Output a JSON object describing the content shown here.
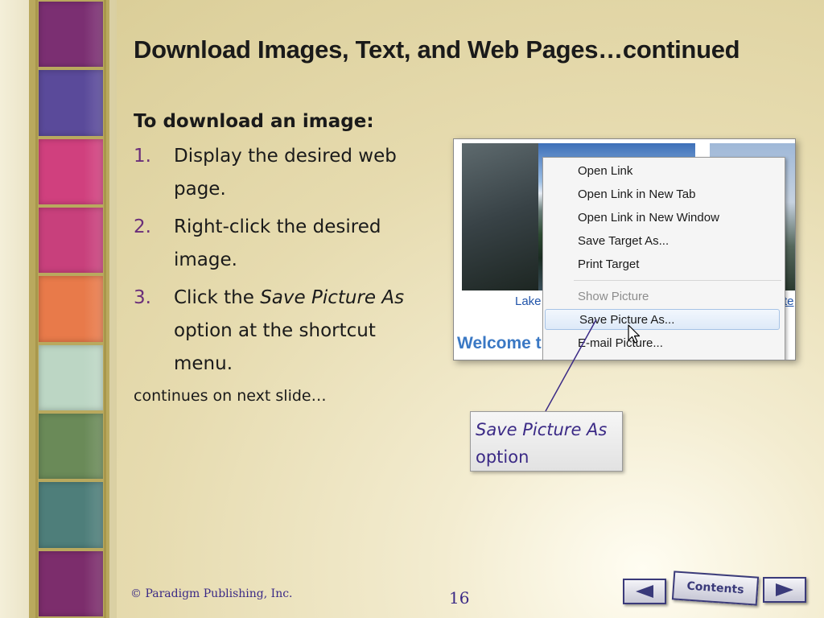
{
  "slide": {
    "title": "Download Images, Text, and Web Pages…continued",
    "subhead": "To download an image:",
    "steps": [
      {
        "num": "1.",
        "text": "Display the desired web page."
      },
      {
        "num": "2.",
        "text": "Right-click the desired image."
      },
      {
        "num": "3.",
        "text_before": "Click the ",
        "text_em": "Save Picture As",
        "text_after": " option at the shortcut menu."
      }
    ],
    "continues": "continues on next slide…"
  },
  "screenshot": {
    "caption_left": "Lake",
    "caption_right": "te",
    "welcome": "Welcome t",
    "menu": [
      {
        "label": "Open Link",
        "state": "normal"
      },
      {
        "label": "Open Link in New Tab",
        "state": "normal"
      },
      {
        "label": "Open Link in New Window",
        "state": "normal"
      },
      {
        "label": "Save Target As...",
        "state": "normal"
      },
      {
        "label": "Print Target",
        "state": "normal"
      },
      {
        "label": "Show Picture",
        "state": "disabled"
      },
      {
        "label": "Save Picture As...",
        "state": "highlighted"
      },
      {
        "label": "E-mail Picture...",
        "state": "normal"
      }
    ]
  },
  "callout": {
    "em": "Save Picture As",
    "rest": "option"
  },
  "footer": {
    "copyright": "© Paradigm Publishing, Inc.",
    "page": "16",
    "contents_label": "Contents"
  },
  "colors": {
    "accent_number": "#6a2e7a",
    "callout_text": "#3b2a86",
    "strip_swatches": [
      "#7b2f72",
      "#5a4a9a",
      "#d0407e",
      "#c8407c",
      "#e87a4a",
      "#bcd6c4",
      "#6a8a58",
      "#4e7e7a",
      "#7c2d6c"
    ]
  },
  "icons": {
    "prev": "left-triangle-icon",
    "next": "right-triangle-icon",
    "cursor": "mouse-pointer-icon"
  }
}
